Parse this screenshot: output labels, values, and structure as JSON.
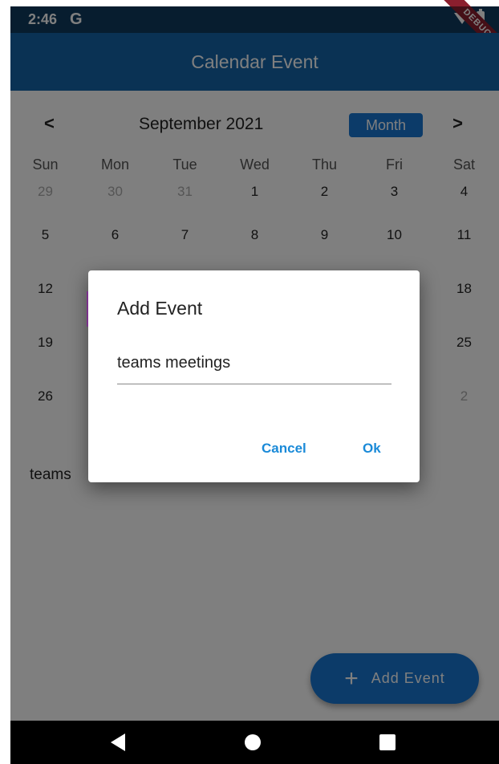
{
  "status_bar": {
    "time": "2:46",
    "g_icon": "G",
    "debug": "DEBUG",
    "icons": [
      "wifi-icon",
      "battery-icon"
    ]
  },
  "app_bar": {
    "title": "Calendar Event"
  },
  "calendar": {
    "prev": "<",
    "next": ">",
    "title": "September 2021",
    "format_button": "Month",
    "days_of_week": [
      "Sun",
      "Mon",
      "Tue",
      "Wed",
      "Thu",
      "Fri",
      "Sat"
    ],
    "weeks": [
      [
        {
          "d": "29",
          "out": true
        },
        {
          "d": "30",
          "out": true
        },
        {
          "d": "31",
          "out": true
        },
        {
          "d": "1",
          "out": false
        },
        {
          "d": "2",
          "out": false
        },
        {
          "d": "3",
          "out": false
        },
        {
          "d": "4",
          "out": false
        }
      ],
      [
        {
          "d": "5",
          "out": false
        },
        {
          "d": "6",
          "out": false
        },
        {
          "d": "7",
          "out": false
        },
        {
          "d": "8",
          "out": false
        },
        {
          "d": "9",
          "out": false
        },
        {
          "d": "10",
          "out": false
        },
        {
          "d": "11",
          "out": false
        }
      ],
      [
        {
          "d": "12",
          "out": false
        },
        {
          "d": "",
          "out": false
        },
        {
          "d": "",
          "out": false
        },
        {
          "d": "",
          "out": false
        },
        {
          "d": "",
          "out": false
        },
        {
          "d": "",
          "out": false
        },
        {
          "d": "18",
          "out": false
        }
      ],
      [
        {
          "d": "19",
          "out": false
        },
        {
          "d": "",
          "out": false
        },
        {
          "d": "",
          "out": false
        },
        {
          "d": "",
          "out": false
        },
        {
          "d": "",
          "out": false
        },
        {
          "d": "",
          "out": false
        },
        {
          "d": "25",
          "out": false
        }
      ],
      [
        {
          "d": "26",
          "out": false
        },
        {
          "d": "",
          "out": false
        },
        {
          "d": "",
          "out": false
        },
        {
          "d": "",
          "out": false
        },
        {
          "d": "",
          "out": false
        },
        {
          "d": "",
          "out": false
        },
        {
          "d": "2",
          "out": true
        }
      ]
    ]
  },
  "event_list": {
    "first_event": "teams"
  },
  "fab": {
    "plus": "+",
    "label": "Add Event"
  },
  "dialog": {
    "title": "Add Event",
    "input_value": "teams meetings",
    "cancel": "Cancel",
    "ok": "Ok"
  },
  "colors": {
    "primary": "#1565a8",
    "accent": "#1976d2",
    "button_text": "#1a8ad8"
  }
}
